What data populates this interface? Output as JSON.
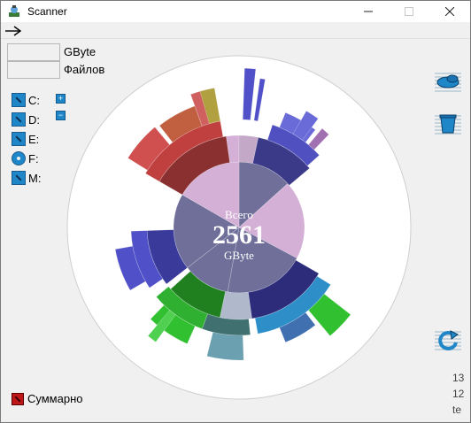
{
  "window": {
    "title": "Scanner"
  },
  "stats": {
    "size_unit": "GByte",
    "files_label": "Файлов"
  },
  "drives": [
    {
      "label": "C:",
      "type": "hdd"
    },
    {
      "label": "D:",
      "type": "hdd"
    },
    {
      "label": "E:",
      "type": "hdd"
    },
    {
      "label": "F:",
      "type": "cd"
    },
    {
      "label": "M:",
      "type": "hdd"
    }
  ],
  "expand_buttons": {
    "plus": "+",
    "minus": "−"
  },
  "chart": {
    "center_top": "Всего",
    "center_value": "2561",
    "center_unit": "GByte"
  },
  "summary": {
    "label": "Суммарно"
  },
  "side_numbers": [
    "13",
    "12",
    "te"
  ],
  "icons": {
    "app": "scanner-app-icon",
    "arrow": "right-arrow-icon",
    "disk_tool": "disk-tool-icon",
    "trash": "trash-icon",
    "refresh": "refresh-icon"
  }
}
